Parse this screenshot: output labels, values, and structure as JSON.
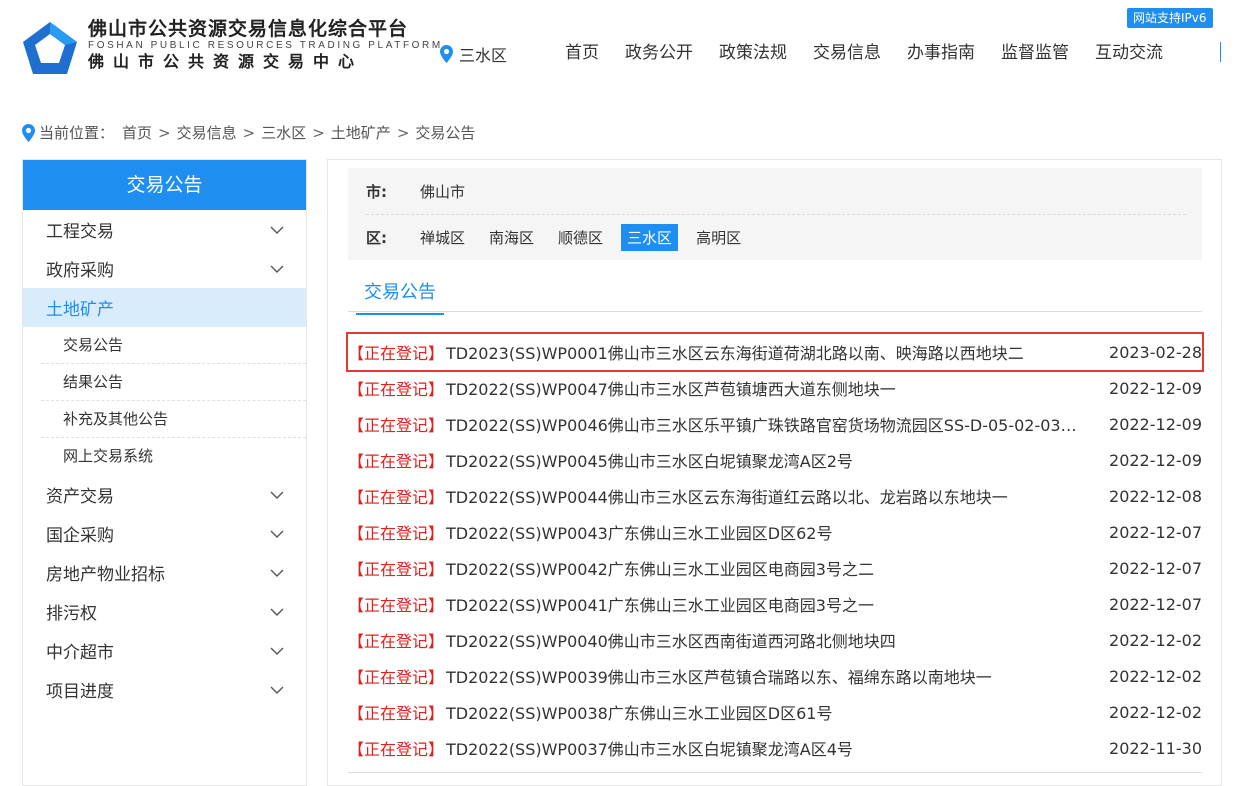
{
  "header": {
    "logo_cn_main": "佛山市公共资源交易信息化综合平台",
    "logo_en": "FOSHAN PUBLIC RESOURCES TRADING PLATFORM",
    "logo_cn_sub": "佛山市公共资源交易中心",
    "location": "三水区",
    "ipv6_badge": "网站支持IPv6",
    "nav": [
      "首页",
      "政务公开",
      "政策法规",
      "交易信息",
      "办事指南",
      "监督监管",
      "互动交流"
    ]
  },
  "breadcrumb": {
    "prefix": "当前位置：",
    "items": [
      "首页",
      "交易信息",
      "三水区",
      "土地矿产",
      "交易公告"
    ]
  },
  "sidebar": {
    "title": "交易公告",
    "items_top": [
      "工程交易",
      "政府采购"
    ],
    "active": "土地矿产",
    "sub_items": [
      "交易公告",
      "结果公告",
      "补充及其他公告",
      "网上交易系统"
    ],
    "items_bottom": [
      "资产交易",
      "国企采购",
      "房地产物业招标",
      "排污权",
      "中介超市",
      "项目进度"
    ]
  },
  "filter": {
    "city_label": "市:",
    "city": "佛山市",
    "district_label": "区:",
    "districts": [
      "禅城区",
      "南海区",
      "顺德区",
      "三水区",
      "高明区"
    ],
    "selected_district": "三水区"
  },
  "tab": {
    "label": "交易公告"
  },
  "list": [
    {
      "status": "【正在登记】",
      "title": "TD2023(SS)WP0001佛山市三水区云东海街道荷湖北路以南、映海路以西地块二",
      "date": "2023-02-28"
    },
    {
      "status": "【正在登记】",
      "title": "TD2022(SS)WP0047佛山市三水区芦苞镇塘西大道东侧地块一",
      "date": "2022-12-09"
    },
    {
      "status": "【正在登记】",
      "title": "TD2022(SS)WP0046佛山市三水区乐平镇广珠铁路官窑货场物流园区SS-D-05-02-03-0...",
      "date": "2022-12-09"
    },
    {
      "status": "【正在登记】",
      "title": "TD2022(SS)WP0045佛山市三水区白坭镇聚龙湾A区2号",
      "date": "2022-12-09"
    },
    {
      "status": "【正在登记】",
      "title": "TD2022(SS)WP0044佛山市三水区云东海街道红云路以北、龙岩路以东地块一",
      "date": "2022-12-08"
    },
    {
      "status": "【正在登记】",
      "title": "TD2022(SS)WP0043广东佛山三水工业园区D区62号",
      "date": "2022-12-07"
    },
    {
      "status": "【正在登记】",
      "title": "TD2022(SS)WP0042广东佛山三水工业园区电商园3号之二",
      "date": "2022-12-07"
    },
    {
      "status": "【正在登记】",
      "title": "TD2022(SS)WP0041广东佛山三水工业园区电商园3号之一",
      "date": "2022-12-07"
    },
    {
      "status": "【正在登记】",
      "title": "TD2022(SS)WP0040佛山市三水区西南街道西河路北侧地块四",
      "date": "2022-12-02"
    },
    {
      "status": "【正在登记】",
      "title": "TD2022(SS)WP0039佛山市三水区芦苞镇合瑞路以东、福绵东路以南地块一",
      "date": "2022-12-02"
    },
    {
      "status": "【正在登记】",
      "title": "TD2022(SS)WP0038广东佛山三水工业园区D区61号",
      "date": "2022-12-02"
    },
    {
      "status": "【正在登记】",
      "title": "TD2022(SS)WP0037佛山市三水区白坭镇聚龙湾A区4号",
      "date": "2022-11-30"
    }
  ],
  "colors": {
    "brand": "#1e8ef0",
    "status_red": "#e0211d",
    "highlight": "#e53935"
  }
}
